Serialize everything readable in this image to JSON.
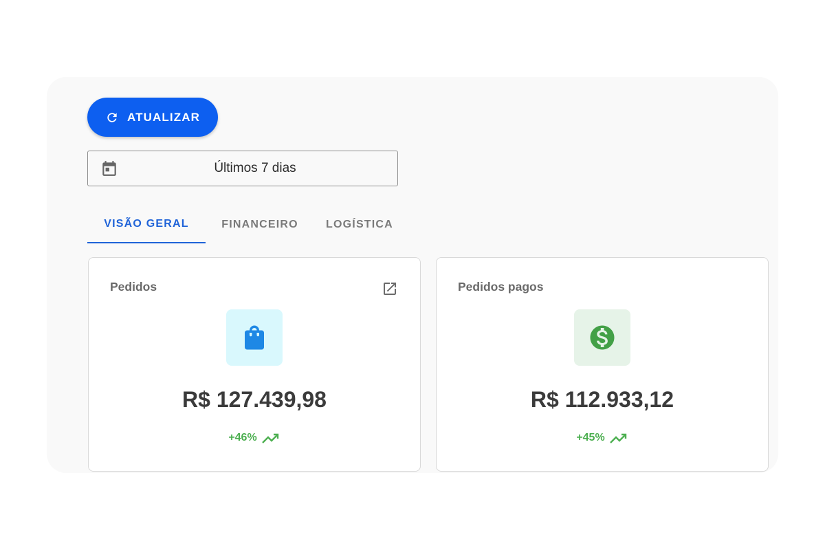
{
  "toolbar": {
    "refresh_label": "ATUALIZAR",
    "refresh_icon": "refresh-icon"
  },
  "date_filter": {
    "icon": "calendar-icon",
    "value": "Últimos 7 dias"
  },
  "tabs": [
    {
      "label": "VISÃO GERAL",
      "active": true
    },
    {
      "label": "FINANCEIRO",
      "active": false
    },
    {
      "label": "LOGÍSTICA",
      "active": false
    }
  ],
  "cards": [
    {
      "title": "Pedidos",
      "icon": "shopping-bag-icon",
      "action_icon": "open-in-new-icon",
      "amount": "R$ 127.439,98",
      "delta": "+46%",
      "trend_icon": "trending-up-icon"
    },
    {
      "title": "Pedidos pagos",
      "icon": "dollar-icon",
      "amount": "R$ 112.933,12",
      "delta": "+45%",
      "trend_icon": "trending-up-icon"
    }
  ],
  "colors": {
    "primary": "#0d5ff0",
    "active_tab": "#1f63d8",
    "positive": "#4caf50",
    "bag_blue": "#1e88e5",
    "dollar_green": "#43a047"
  }
}
